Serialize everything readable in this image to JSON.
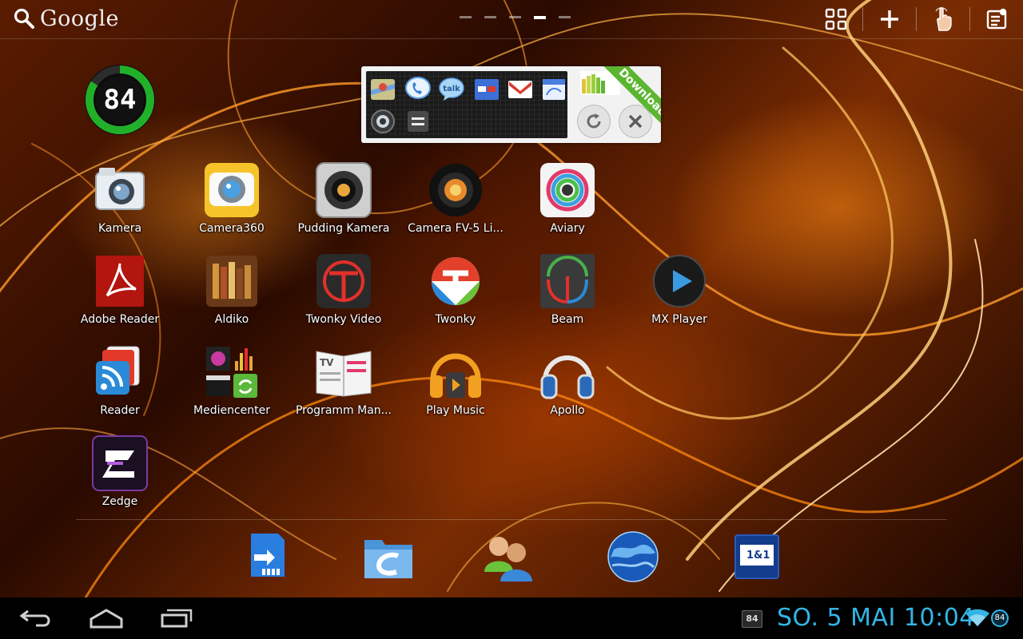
{
  "search": {
    "label": "Google"
  },
  "pager": {
    "pages": 5,
    "active": 4
  },
  "battery_widget": {
    "level": "84",
    "fraction": 0.84
  },
  "toggle_widget": {
    "download_label": "Download"
  },
  "apps": [
    {
      "label": "Kamera",
      "icon": "camera-icon"
    },
    {
      "label": "Camera360",
      "icon": "camera360-icon"
    },
    {
      "label": "Pudding Kamera",
      "icon": "pudding-camera-icon"
    },
    {
      "label": "Camera FV-5 Li...",
      "icon": "camera-fv5-icon"
    },
    {
      "label": "Aviary",
      "icon": "aviary-icon"
    },
    {
      "label": "Adobe Reader",
      "icon": "adobe-reader-icon"
    },
    {
      "label": "Aldiko",
      "icon": "aldiko-icon"
    },
    {
      "label": "Twonky Video",
      "icon": "twonky-video-icon"
    },
    {
      "label": "Twonky",
      "icon": "twonky-icon"
    },
    {
      "label": "Beam",
      "icon": "beam-icon"
    },
    {
      "label": "MX Player",
      "icon": "mx-player-icon"
    },
    {
      "label": "Reader",
      "icon": "reader-icon"
    },
    {
      "label": "Mediencenter",
      "icon": "mediencenter-icon"
    },
    {
      "label": "Programm Man...",
      "icon": "programm-manager-icon"
    },
    {
      "label": "Play Music",
      "icon": "play-music-icon"
    },
    {
      "label": "Apollo",
      "icon": "apollo-icon"
    },
    {
      "label": "Zedge",
      "icon": "zedge-icon"
    }
  ],
  "dock": [
    "sd-transfer-icon",
    "file-manager-icon",
    "contacts-icon",
    "browser-globe-icon",
    "one-and-one-icon"
  ],
  "dock_label_1and1": "1&1",
  "status": {
    "clock": "SO. 5 MAI 10:04",
    "notification_badge": "84",
    "battery_badge": "84"
  },
  "colors": {
    "accent": "#33b5e5",
    "battery_ring": "#22b02a"
  }
}
